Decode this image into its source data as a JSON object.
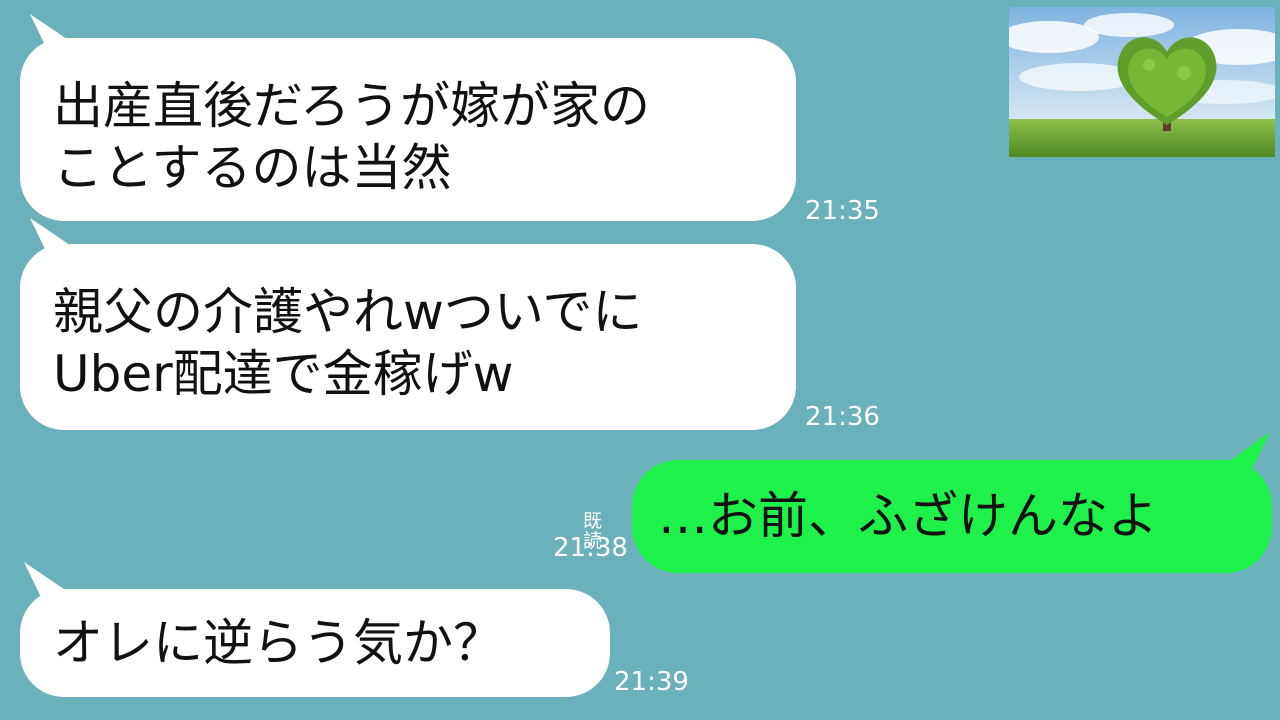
{
  "messages": [
    {
      "sender": "other",
      "lines": [
        "出産直後だろうが嫁が家の",
        "ことするのは当然"
      ],
      "time": "21:35"
    },
    {
      "sender": "other",
      "lines": [
        "親父の介護やれwついでに",
        "Uber配達で金稼げw"
      ],
      "time": "21:36"
    },
    {
      "sender": "self",
      "lines": [
        "…お前、ふざけんなよ"
      ],
      "time": "21:38",
      "read_label": "既読"
    },
    {
      "sender": "other",
      "lines": [
        "オレに逆らう気か？"
      ],
      "time": "21:39"
    }
  ],
  "colors": {
    "background": "#6bb1bb",
    "incoming_bubble": "#ffffff",
    "outgoing_bubble": "#1ef24a",
    "meta_text": "#ffffff"
  },
  "photo": {
    "icon": "heart-tree-landscape-image"
  }
}
